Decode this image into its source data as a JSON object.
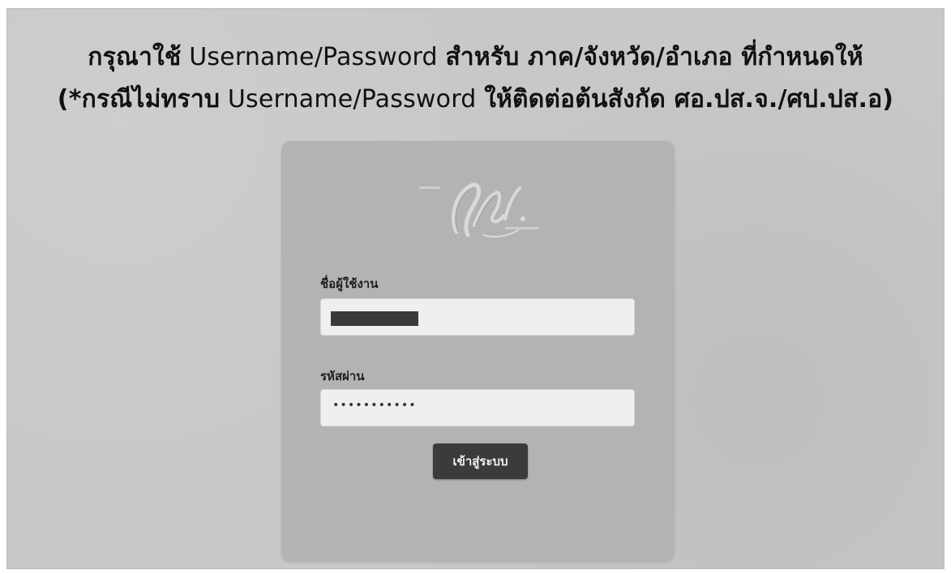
{
  "instruction": {
    "line1_thai_a": "กรุณาใช้",
    "line1_latin": " Username/Password ",
    "line1_thai_b": "สำหรับ ภาค/จังหวัด/อำเภอ ที่กำหนดให้",
    "line2_thai_a": "(*กรณีไม่ทราบ",
    "line2_latin": " Username/Password ",
    "line2_thai_b": "ให้ติดต่อต้นสังกัด ศอ.ปส.จ./ศป.ปส.อ)"
  },
  "login": {
    "username_label": "ชื่อผู้ใช้งาน",
    "password_label": "รหัสผ่าน",
    "password_value": "•••••••••••",
    "submit_label": "เข้าสู่ระบบ"
  }
}
